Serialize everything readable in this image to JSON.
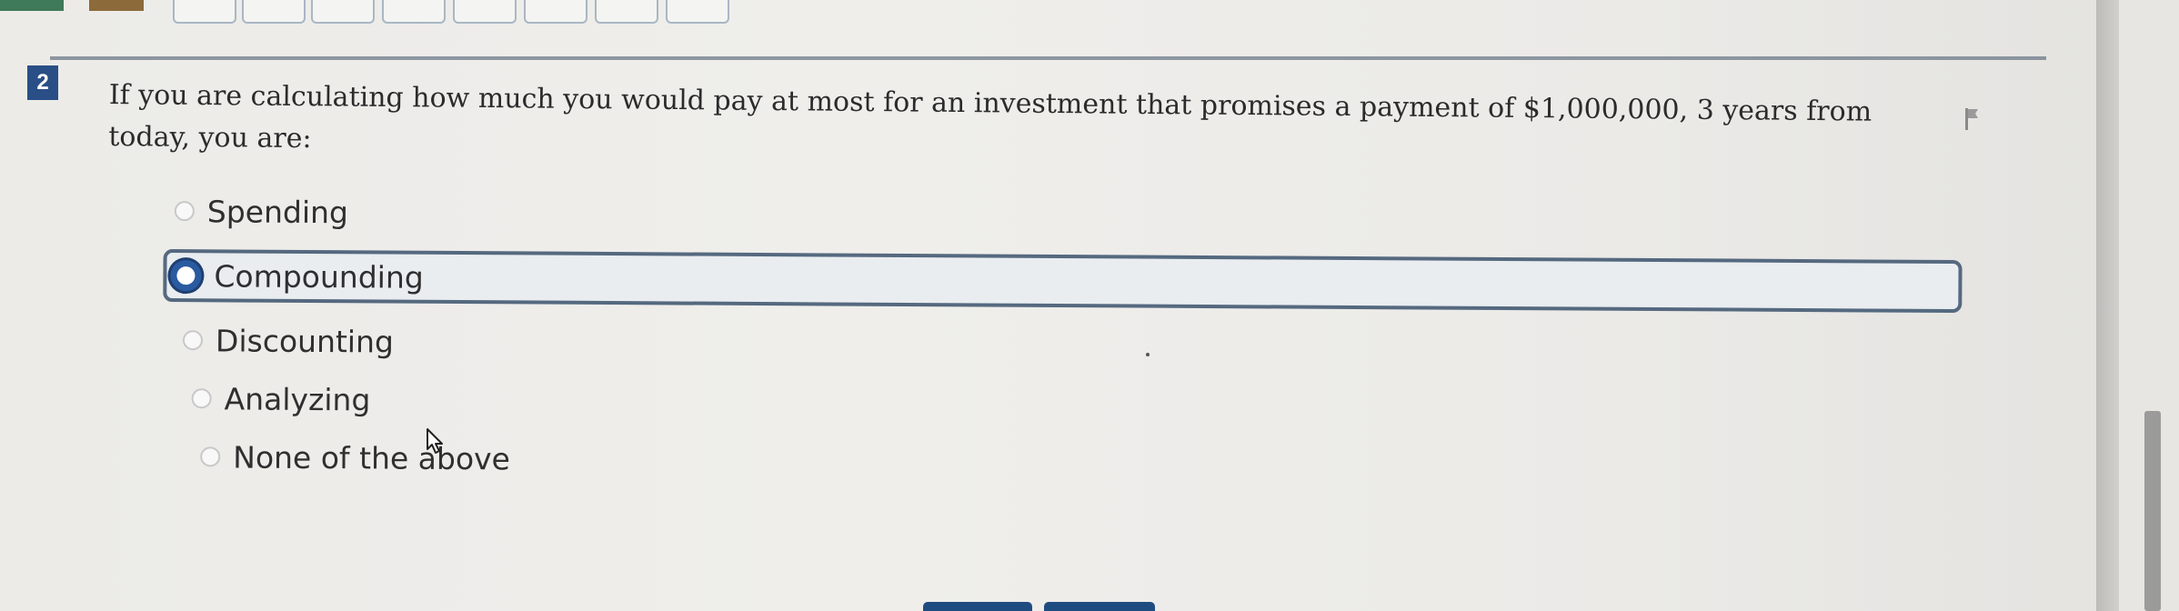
{
  "question": {
    "number": "2",
    "text": "If you are calculating how much you would pay at most for an investment that promises a payment of $1,000,000, 3 years from today, you are:"
  },
  "options": [
    {
      "label": "Spending",
      "selected": false
    },
    {
      "label": "Compounding",
      "selected": true
    },
    {
      "label": "Discounting",
      "selected": false
    },
    {
      "label": "Analyzing",
      "selected": false
    },
    {
      "label": "None of the above",
      "selected": false
    }
  ],
  "icons": {
    "flag": "flag-icon",
    "cursor": "mouse-pointer-icon"
  },
  "colors": {
    "question_badge": "#2a4f86",
    "selected_border": "#55697f",
    "radio_selected": "#2a5aa0",
    "nav_button": "#1f4c80"
  }
}
